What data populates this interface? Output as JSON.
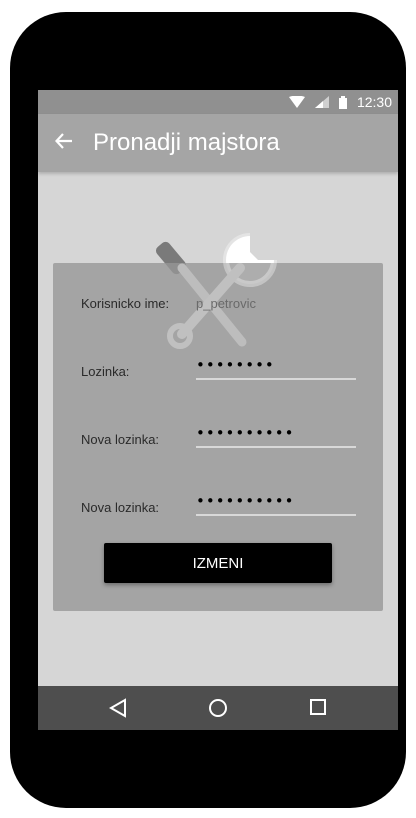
{
  "status_bar": {
    "time": "12:30"
  },
  "app_bar": {
    "title": "Pronadji majstora"
  },
  "form": {
    "username_label": "Korisnicko ime:",
    "username_value": "p_petrovic",
    "password_label": "Lozinka:",
    "password_value": "••••••••",
    "new_password_label": "Nova lozinka:",
    "new_password_value": "••••••••••",
    "confirm_password_label": "Nova lozinka:",
    "confirm_password_value": "••••••••••",
    "submit_label": "IZMENI"
  },
  "icons": {
    "back": "arrow-left-icon",
    "logo": "wrench-screwdriver-icon",
    "wifi": "wifi-icon",
    "signal": "signal-icon",
    "battery": "battery-icon",
    "nav_back": "triangle-back-icon",
    "nav_home": "circle-home-icon",
    "nav_recent": "square-recents-icon"
  },
  "colors": {
    "screen_background": "#d6d6d6",
    "status_bar": "#909090",
    "app_bar": "#a5a5a5",
    "card": "#969696",
    "button": "#000000",
    "nav_bar": "#4e4e4e"
  }
}
